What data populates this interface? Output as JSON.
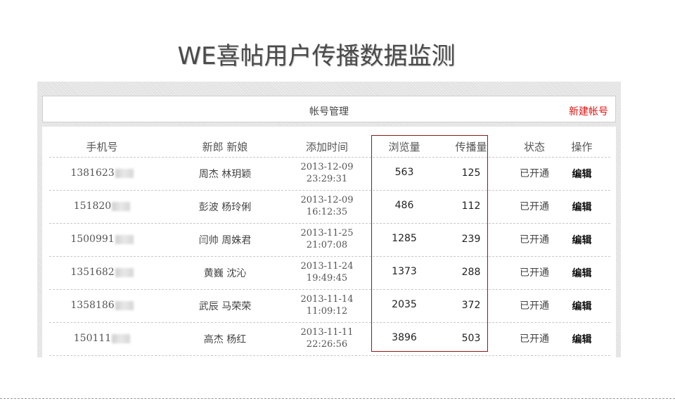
{
  "page_title": "WE喜帖用户传播数据监测",
  "topbar": {
    "title": "帐号管理",
    "new_account": "新建帐号"
  },
  "table": {
    "headers": [
      "手机号",
      "新郎 新娘",
      "添加时间",
      "浏览量",
      "传播量",
      "状态",
      "操作"
    ],
    "rows": [
      {
        "phone": "1381623",
        "couple": "周杰 林玥颖",
        "date": "2013-12-09",
        "time": "23:29:31",
        "views": "563",
        "spread": "125",
        "status": "已开通",
        "action": "编辑"
      },
      {
        "phone": "151820",
        "couple": "彭波 杨玲俐",
        "date": "2013-12-09",
        "time": "16:12:35",
        "views": "486",
        "spread": "112",
        "status": "已开通",
        "action": "编辑"
      },
      {
        "phone": "1500991",
        "couple": "闫帅 周姝君",
        "date": "2013-11-25",
        "time": "21:07:08",
        "views": "1285",
        "spread": "239",
        "status": "已开通",
        "action": "编辑"
      },
      {
        "phone": "1351682",
        "couple": "黄巍 沈沁",
        "date": "2013-11-24",
        "time": "19:49:45",
        "views": "1373",
        "spread": "288",
        "status": "已开通",
        "action": "编辑"
      },
      {
        "phone": "1358186",
        "couple": "武辰 马荣荣",
        "date": "2013-11-14",
        "time": "11:09:12",
        "views": "2035",
        "spread": "372",
        "status": "已开通",
        "action": "编辑"
      },
      {
        "phone": "150111",
        "couple": "高杰 杨红",
        "date": "2013-11-11",
        "time": "22:26:56",
        "views": "3896",
        "spread": "503",
        "status": "已开通",
        "action": "编辑"
      }
    ]
  },
  "colors": {
    "accent_red": "#e01010",
    "highlight_border": "#8b1a1a",
    "frame_bg": "#e6e6e6"
  }
}
